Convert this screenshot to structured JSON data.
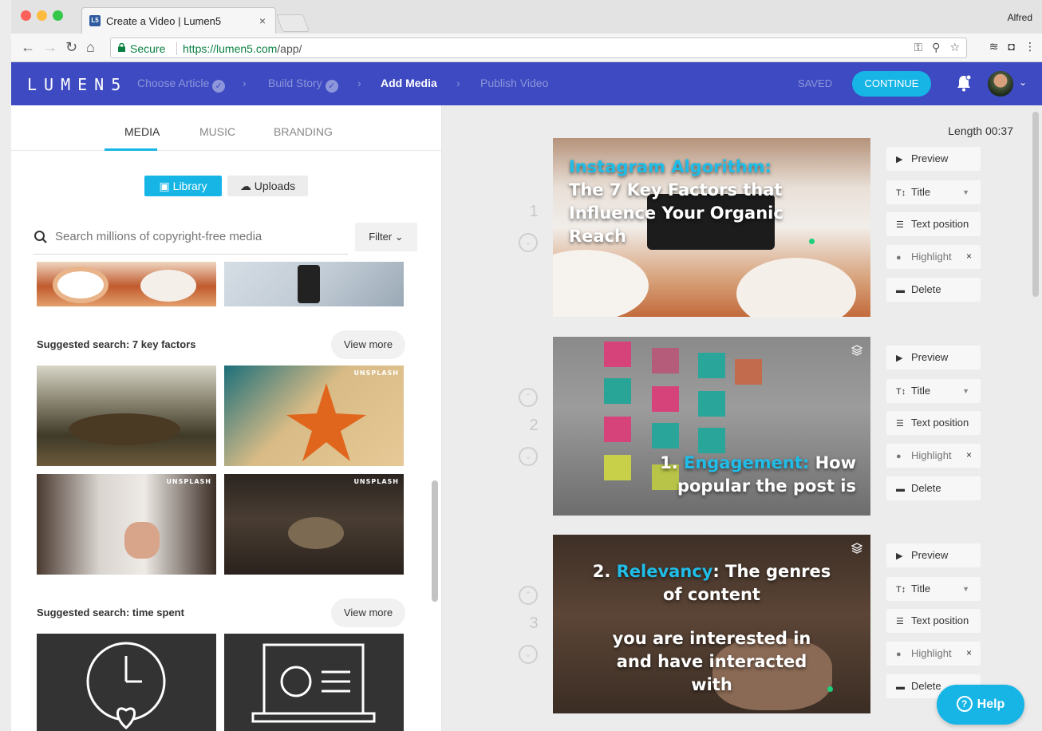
{
  "browser": {
    "tab_title": "Create a Video | Lumen5",
    "tab_favicon": "L5",
    "tab_close": "×",
    "profile_name": "Alfred",
    "secure_label": "Secure",
    "url_host": "https://lumen5.com",
    "url_path": "/app/"
  },
  "app": {
    "logo": "LUMEN5",
    "steps": {
      "choose_article": "Choose Article",
      "build_story": "Build Story",
      "add_media": "Add Media",
      "publish_video": "Publish Video"
    },
    "saved": "SAVED",
    "continue": "CONTINUE"
  },
  "media_panel": {
    "tabs": {
      "media": "MEDIA",
      "music": "MUSIC",
      "branding": "BRANDING"
    },
    "library": "Library",
    "uploads": "Uploads",
    "search_placeholder": "Search millions of copyright-free media",
    "filter": "Filter",
    "suggest1": {
      "title": "Suggested search: 7 key factors",
      "view_more": "View more"
    },
    "suggest2": {
      "title": "Suggested search: time spent",
      "view_more": "View more"
    },
    "unsplash": "UNSPLASH"
  },
  "story": {
    "length": "Length 00:37",
    "scenes": [
      {
        "number": "1",
        "highlight": "Instagram Algorithm:",
        "lines": [
          "The 7 Key Factors that",
          "Influence Your Organic",
          "Reach"
        ]
      },
      {
        "number": "2",
        "prefix": "1. ",
        "highlight": "Engagement:",
        "after": " How",
        "line2": "popular the post is"
      },
      {
        "number": "3",
        "prefix": "2. ",
        "highlight": "Relevancy",
        "after": ": The genres",
        "line2": "of content",
        "line3": "you are interested in",
        "line4": "and have interacted",
        "line5": "with"
      }
    ],
    "actions": {
      "preview": "Preview",
      "title": "Title",
      "text_position": "Text position",
      "highlight": "Highlight",
      "delete": "Delete",
      "remove": "×"
    }
  },
  "help": "Help",
  "colors": {
    "accent": "#17b5e6",
    "header": "#3e4ac2",
    "highlight": "#1fbde8"
  }
}
